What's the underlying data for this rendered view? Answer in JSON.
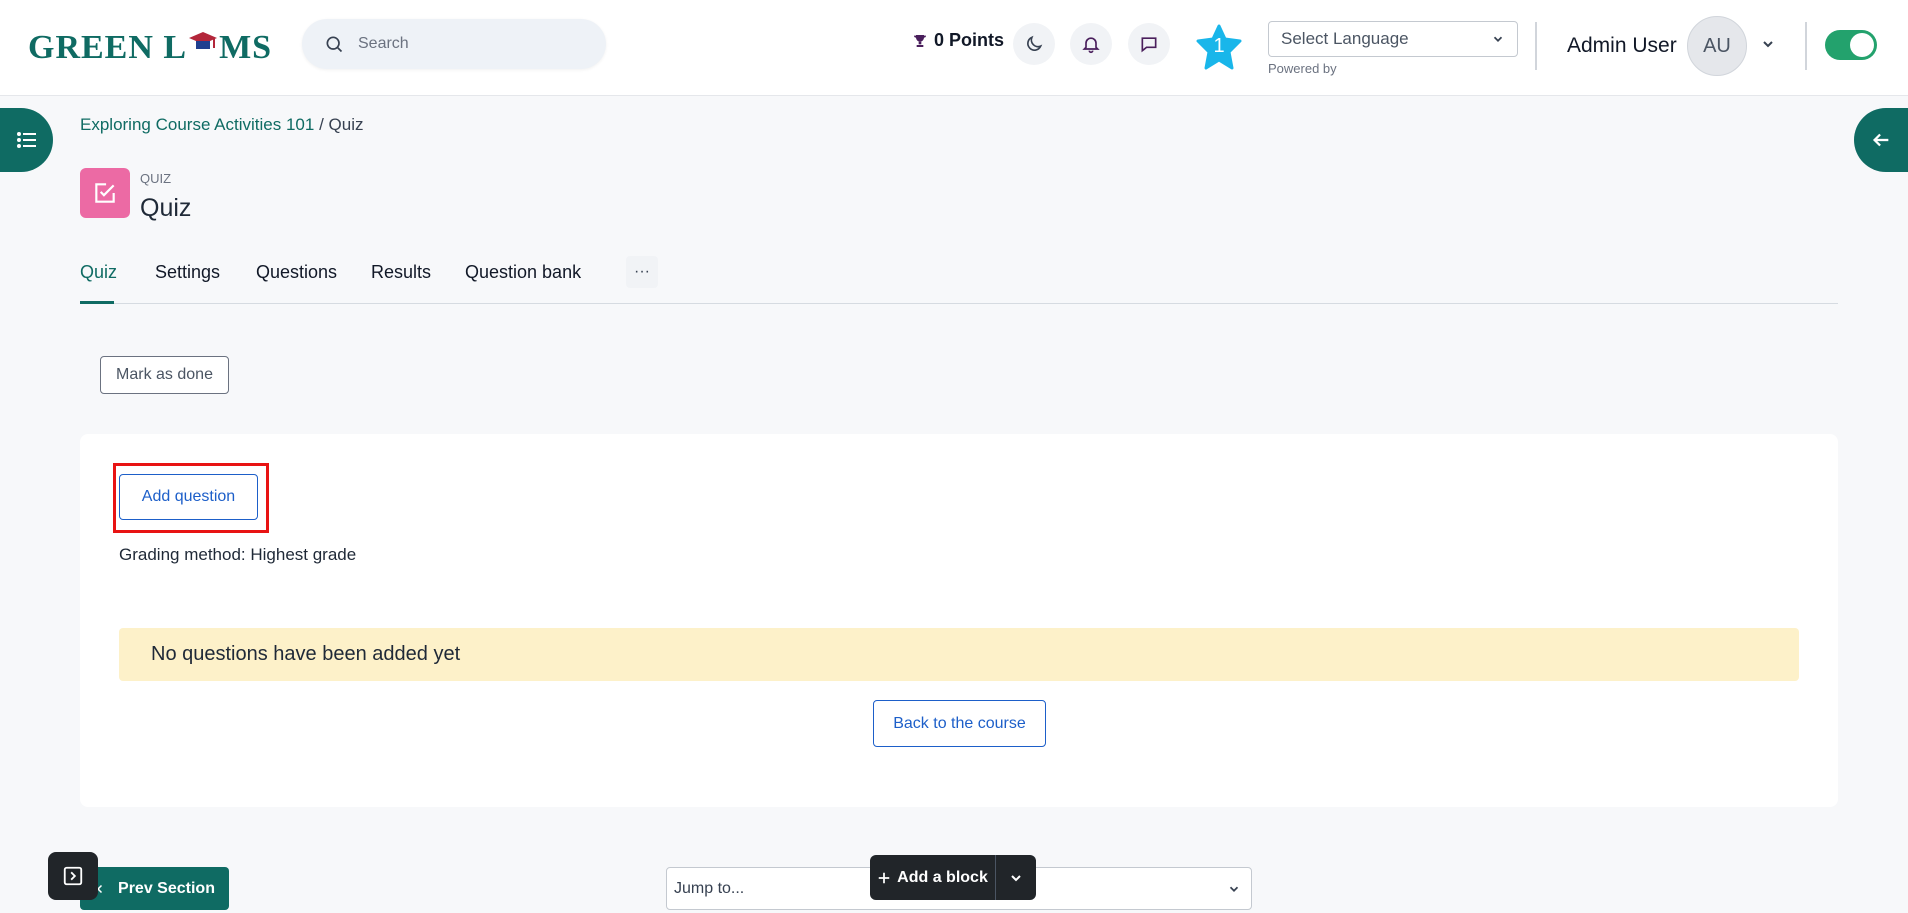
{
  "header": {
    "logo_text_1": "GREEN L",
    "logo_text_2": "MS",
    "search_placeholder": "Search",
    "points": "0 Points",
    "star_count": "1",
    "language_select": "Select Language",
    "powered_by": "Powered by",
    "user_name": "Admin User",
    "avatar_initials": "AU"
  },
  "breadcrumb": {
    "course": "Exploring Course Activities 101",
    "separator": "/",
    "current": "Quiz"
  },
  "activity": {
    "type_label": "QUIZ",
    "title": "Quiz"
  },
  "tabs": [
    {
      "label": "Quiz",
      "active": true
    },
    {
      "label": "Settings"
    },
    {
      "label": "Questions"
    },
    {
      "label": "Results"
    },
    {
      "label": "Question bank"
    }
  ],
  "tab_more": "···",
  "mark_done": "Mark as done",
  "main": {
    "add_question": "Add question",
    "grading_method": "Grading method: Highest grade",
    "notice": "No questions have been added yet",
    "back_to_course": "Back to the course"
  },
  "footer": {
    "prev_section": "Prev Section",
    "jump_to": "Jump to...",
    "add_block": "Add a block"
  },
  "colors": {
    "brand": "#0f6b63",
    "link_blue": "#1d5fc9",
    "highlight_red": "#e81313",
    "notice_bg": "#fdf1c9",
    "quiz_icon_bg": "#ec6aa4",
    "toggle_on": "#23a26d"
  },
  "icons": [
    "search-icon",
    "trophy-icon",
    "moon-icon",
    "bell-icon",
    "chat-icon",
    "star-icon",
    "chevron-down-icon",
    "list-icon",
    "arrow-left-icon",
    "checkbox-edit-icon",
    "chevron-left-icon",
    "plus-icon",
    "sidebar-toggle-icon"
  ]
}
